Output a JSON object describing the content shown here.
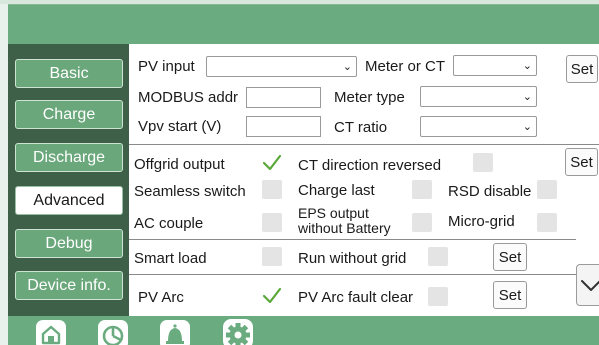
{
  "sidebar": {
    "items": [
      {
        "label": "Basic"
      },
      {
        "label": "Charge"
      },
      {
        "label": "Discharge"
      },
      {
        "label": "Advanced",
        "active": true
      },
      {
        "label": "Debug"
      },
      {
        "label": "Device info."
      }
    ]
  },
  "section1": {
    "pv_input_label": "PV input",
    "pv_input_value": "",
    "meter_ct_label": "Meter or CT",
    "meter_ct_value": "",
    "set_label": "Set",
    "modbus_label": "MODBUS addr",
    "modbus_value": "",
    "meter_type_label": "Meter type",
    "meter_type_value": "",
    "vpv_label": "Vpv start (V)",
    "vpv_value": "",
    "ct_ratio_label": "CT ratio",
    "ct_ratio_value": ""
  },
  "section2": {
    "offgrid_label": "Offgrid output",
    "offgrid_checked": true,
    "ct_dir_label": "CT direction reversed",
    "set_label": "Set",
    "seamless_label": "Seamless switch",
    "charge_last_label": "Charge last",
    "rsd_label": "RSD disable",
    "ac_couple_label": "AC couple",
    "eps_label": "EPS output without Battery",
    "microgrid_label": "Micro-grid"
  },
  "section3": {
    "smart_load_label": "Smart load",
    "run_wo_grid_label": "Run without grid",
    "set_label": "Set"
  },
  "section4": {
    "pv_arc_label": "PV Arc",
    "pv_arc_checked": true,
    "pv_arc_fault_label": "PV Arc fault clear",
    "set_label": "Set"
  },
  "footer": {
    "icons": [
      "home-icon",
      "pie-chart-icon",
      "bell-icon",
      "gear-icon"
    ]
  },
  "colors": {
    "header_green": "#6aac80",
    "sidebar_dark": "#3e5f48",
    "sidebar_button": "#6aa77b",
    "check_green": "#5aa83a"
  }
}
